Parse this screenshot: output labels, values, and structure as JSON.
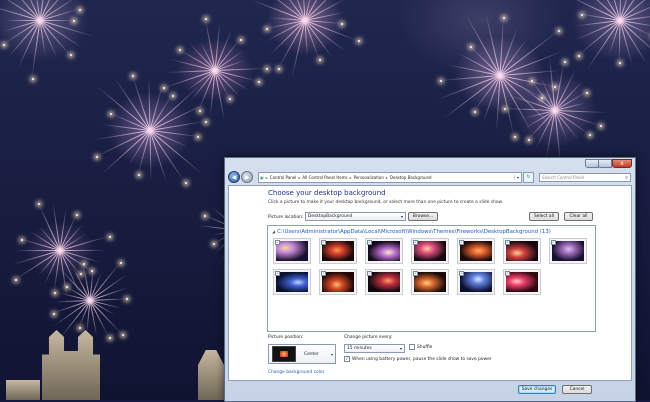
{
  "window": {
    "address": {
      "crumbs": [
        "Control Panel",
        "All Control Panel Items",
        "Personalization",
        "Desktop Background"
      ]
    },
    "search_placeholder": "Search Control Panel",
    "close_glyph": "x"
  },
  "page": {
    "title": "Choose your desktop background",
    "subtitle": "Click a picture to make it your desktop background, or select more than one picture to create a slide show.",
    "location_label": "Picture location:",
    "location_value": "DesktopBackground",
    "browse_label": "Browse...",
    "select_all_label": "Select all",
    "clear_all_label": "Clear all",
    "folder_path": "C:\\Users\\Administrator\\AppData\\Local\\Microsoft\\Windows\\Themes\\Fireworks\\DesktopBackground (13)",
    "thumbnails": [
      {
        "checked": true,
        "colors": [
          "#1a1030",
          "#c88ad8",
          "#f0d8a0"
        ]
      },
      {
        "checked": true,
        "colors": [
          "#1c0808",
          "#d84030",
          "#f0a040"
        ]
      },
      {
        "checked": true,
        "colors": [
          "#120818",
          "#b870d0",
          "#ffe8c0"
        ]
      },
      {
        "checked": true,
        "colors": [
          "#180810",
          "#e05080",
          "#ffd0a0"
        ]
      },
      {
        "checked": true,
        "colors": [
          "#1c0a08",
          "#e06030",
          "#ffb060"
        ]
      },
      {
        "checked": true,
        "colors": [
          "#140810",
          "#d04040",
          "#ffd090"
        ]
      },
      {
        "checked": true,
        "colors": [
          "#181030",
          "#a070c0",
          "#e0c0f0"
        ]
      },
      {
        "checked": true,
        "colors": [
          "#0a1030",
          "#4060d0",
          "#c0d8ff"
        ]
      },
      {
        "checked": true,
        "colors": [
          "#200808",
          "#d04828",
          "#ffc070"
        ]
      },
      {
        "checked": true,
        "colors": [
          "#100810",
          "#c03040",
          "#ffa060"
        ]
      },
      {
        "checked": true,
        "colors": [
          "#180a08",
          "#d86830",
          "#ffd080"
        ]
      },
      {
        "checked": true,
        "colors": [
          "#0c1030",
          "#6080e0",
          "#e0e8ff"
        ]
      },
      {
        "checked": true,
        "colors": [
          "#300810",
          "#f04070",
          "#ffd0c0"
        ]
      }
    ],
    "position_label": "Picture position:",
    "position_value": "Center",
    "change_label": "Change picture every:",
    "interval_value": "15 minutes",
    "shuffle_label": "Shuffle",
    "shuffle_checked": false,
    "battery_label": "When using battery power, pause the slide show to save power",
    "battery_checked": true,
    "bg_color_link": "Change background color",
    "save_label": "Save changes",
    "cancel_label": "Cancel"
  }
}
